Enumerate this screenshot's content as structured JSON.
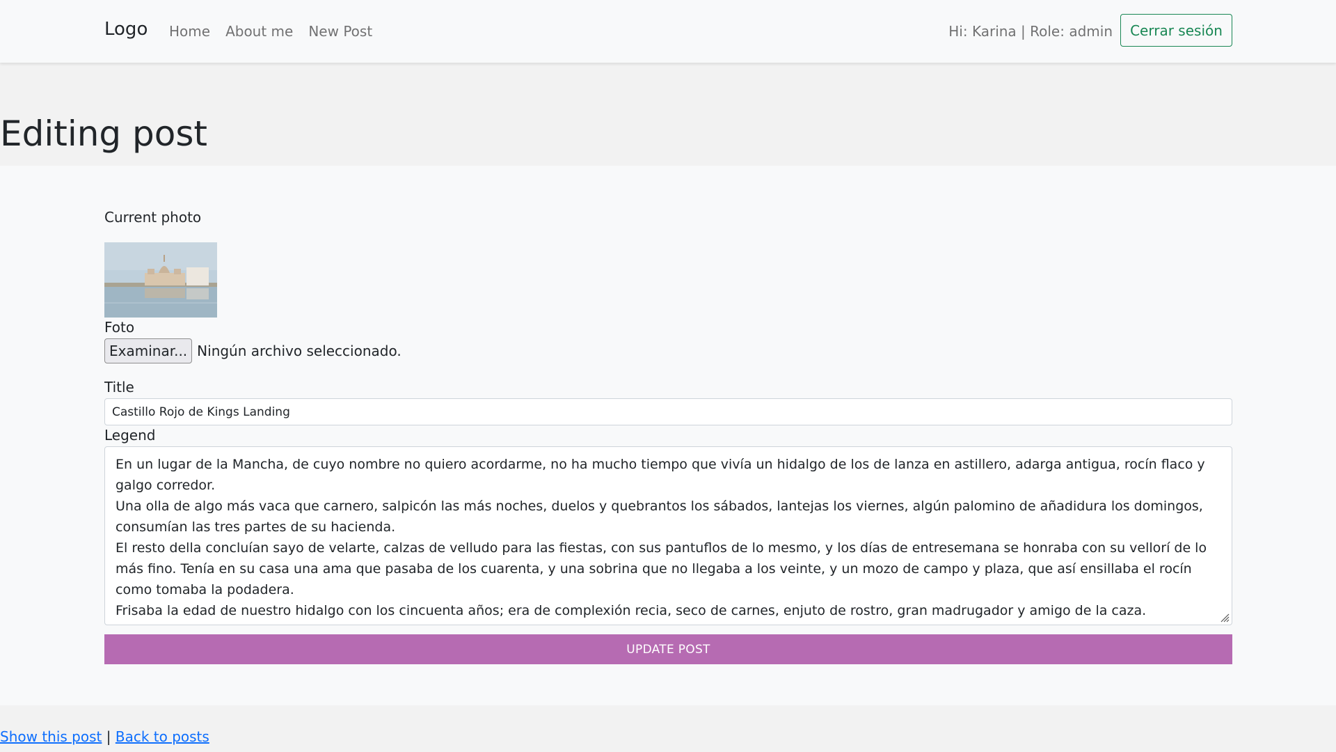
{
  "navbar": {
    "brand": "Logo",
    "links": [
      "Home",
      "About me",
      "New Post"
    ],
    "greeting": "Hi: Karina | Role: admin",
    "logout_label": "Cerrar sesión"
  },
  "page": {
    "title": "Editing post"
  },
  "form": {
    "current_photo_label": "Current photo",
    "photo_field_label": "Foto",
    "file_button_label": "Examinar...",
    "file_status": "Ningún archivo seleccionado.",
    "title_label": "Title",
    "title_value": "Castillo Rojo de Kings Landing",
    "legend_label": "Legend",
    "legend_paragraphs": [
      "En un lugar de la Mancha, de cuyo nombre no quiero acordarme, no ha mucho tiempo que vivía un hidalgo de los de lanza en astillero, adarga antigua, rocín flaco y galgo corredor.",
      "Una olla de algo más vaca que carnero, salpicón las más noches, duelos y quebrantos los sábados, lantejas los viernes, algún palomino de añadidura los domingos, consumían las tres partes de su hacienda.",
      "El resto della concluían sayo de velarte, calzas de velludo para las fiestas, con sus pantuflos de lo mesmo, y los días de entresemana se honraba con su vellorí de lo más fino. Tenía en su casa una ama que pasaba de los cuarenta, y una sobrina que no llegaba a los veinte, y un mozo de campo y plaza, que así ensillaba el rocín como tomaba la podadera.",
      "Frisaba la edad de nuestro hidalgo con los cincuenta años; era de complexión recia, seco de carnes, enjuto de rostro, gran madrugador y amigo de la caza."
    ],
    "submit_label": "UPDATE POST"
  },
  "footer": {
    "show_link": "Show this post",
    "separator": "|",
    "back_link": "Back to posts"
  },
  "colors": {
    "accent_button": "#b66bb2",
    "logout": "#198754",
    "link": "#0d6efd"
  }
}
